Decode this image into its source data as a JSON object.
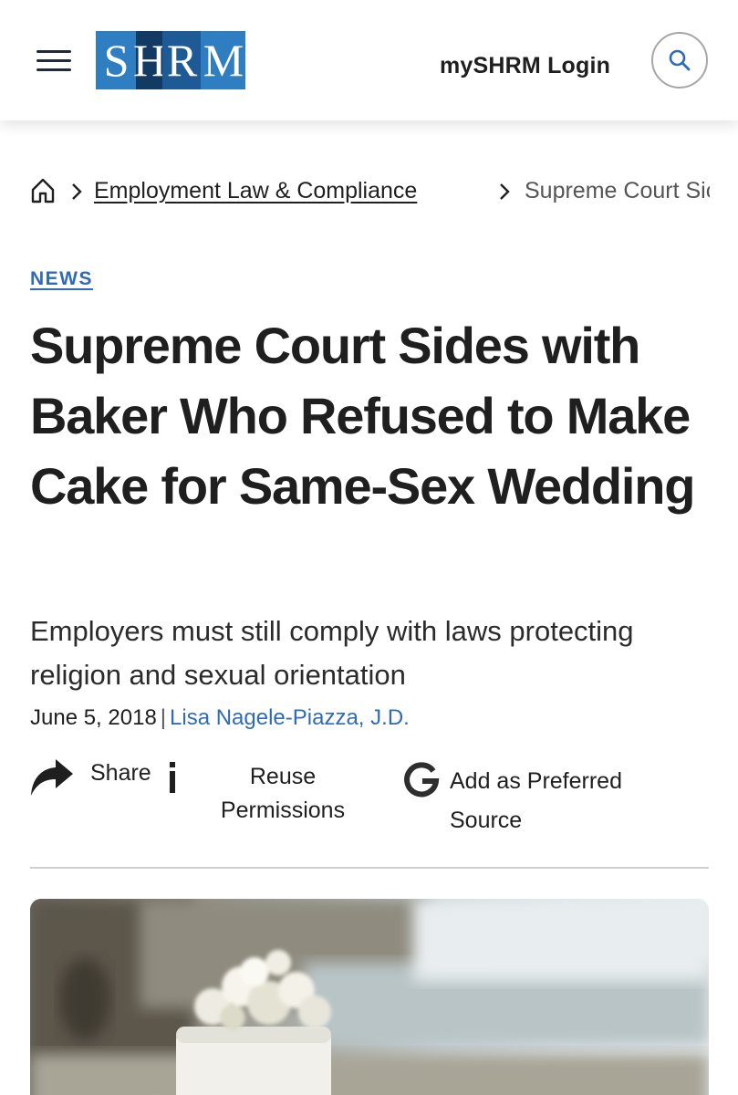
{
  "header": {
    "logo_text": "SHRM",
    "logo_letters": [
      "S",
      "H",
      "R",
      "M"
    ],
    "login_label": "mySHRM Login",
    "icons": {
      "menu": "hamburger-menu-icon",
      "search": "search-icon"
    },
    "colors": {
      "logo_light": "#2f7ec2",
      "logo_dark": "#133a63",
      "logo_mid": "#1e5a95"
    }
  },
  "breadcrumb": {
    "home_icon": "home-icon",
    "items": [
      {
        "label": "Employment Law & Compliance"
      },
      {
        "label": "Supreme Court Sic"
      }
    ]
  },
  "article": {
    "kicker": "NEWS",
    "headline": "Supreme Court Sides with Baker Who Refused to Make Cake for Same-Sex Wedding",
    "deck": "Employers must still comply with laws protecting religion and sexual orientation",
    "date": "June 5, 2018",
    "separator": "|",
    "author": "Lisa Nagele-Piazza, J.D.",
    "link_color": "#2f6cb5"
  },
  "actions": {
    "share_label": "Share",
    "reuse_label": "Reuse Permissions",
    "preferred_label": "Add as Preferred Source",
    "icons": {
      "share": "share-arrow-icon",
      "info": "info-icon",
      "google": "google-g-icon"
    }
  },
  "hero_image": {
    "subject": "wedding-cake-photo"
  }
}
